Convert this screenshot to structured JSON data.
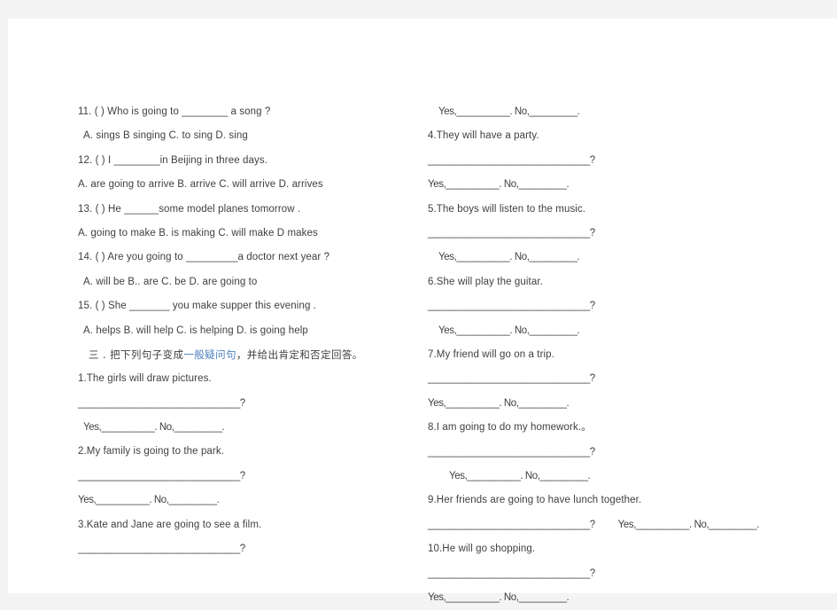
{
  "page": {
    "background": "#f4f4f4",
    "paper": "#ffffff",
    "text_color": "#3f3f3f",
    "highlight_color": "#4a7ebb"
  },
  "left_column": {
    "questions": [
      {
        "stem": "11. (        )   Who is going to ________ a song ?",
        "options": "A. sings        B singing      C. to sing        D. sing"
      },
      {
        "stem": "12. (      ) I ________in Beijing in three days.",
        "options": "A.    are going to arrive   B. arrive   C. will arrive    D. arrives"
      },
      {
        "stem": "13. (       ) He ______some model planes tomorrow .",
        "options": "A.   going to make   B. is making   C. will make    D makes"
      },
      {
        "stem": "14. (      ) Are you going to _________a doctor next year ?",
        "options": "A. will be     B.. are        C. be         D. are going to"
      },
      {
        "stem": "15. (       ) She _______ you make supper this evening .",
        "options": "A. helps       B. will help    C. is helping     D. is going help"
      }
    ],
    "section_heading": {
      "prefix": "三 . 把下列句子变成",
      "highlight": "一般疑问句",
      "suffix": "，并给出肯定和否定回答。"
    },
    "exercises": [
      {
        "sentence": "1.The    girls    will    draw     pictures.",
        "answer_line": "_______________________________?",
        "yes_no": "Yes,__________. No,_________."
      },
      {
        "sentence": "2.My    family    is   going     to    the    park.",
        "answer_line": "_______________________________?",
        "yes_no": "Yes,__________. No,_________."
      },
      {
        "sentence": "3.Kate    and    Jane   are   going    to    see    a    film.",
        "answer_line": "_______________________________?",
        "yes_no": ""
      }
    ]
  },
  "right_column": {
    "top_yes_no": "Yes,__________. No,_________.",
    "exercises": [
      {
        "sentence": "4.They    will    have    a    party.",
        "answer_line": "_______________________________?",
        "yes_no": "Yes,__________. No,_________."
      },
      {
        "sentence": "5.The    boys    will    listen    to    the    music.",
        "answer_line": "_______________________________?",
        "yes_no": "Yes,__________. No,_________."
      },
      {
        "sentence": "6.She    will    play    the    guitar.",
        "answer_line": "_______________________________?",
        "yes_no": "Yes,__________. No,_________."
      },
      {
        "sentence": "7.My    friend    will    go    on    a    trip.",
        "answer_line": "_______________________________?",
        "yes_no": "Yes,__________. No,_________."
      },
      {
        "sentence": "8.I    am    going    to    do    my homework.。",
        "answer_line": "_______________________________?",
        "yes_no": "Yes,__________. No,_________."
      },
      {
        "sentence": "9.Her friends    are    going    to    have    lunch    together.",
        "answer_line": "_______________________________?",
        "yes_no": "Yes,__________. No,_________.",
        "inline_yes_no": true
      },
      {
        "sentence": "10.He    will    go    shopping.",
        "answer_line": "_______________________________?",
        "yes_no": "Yes,__________. No,_________."
      }
    ]
  }
}
